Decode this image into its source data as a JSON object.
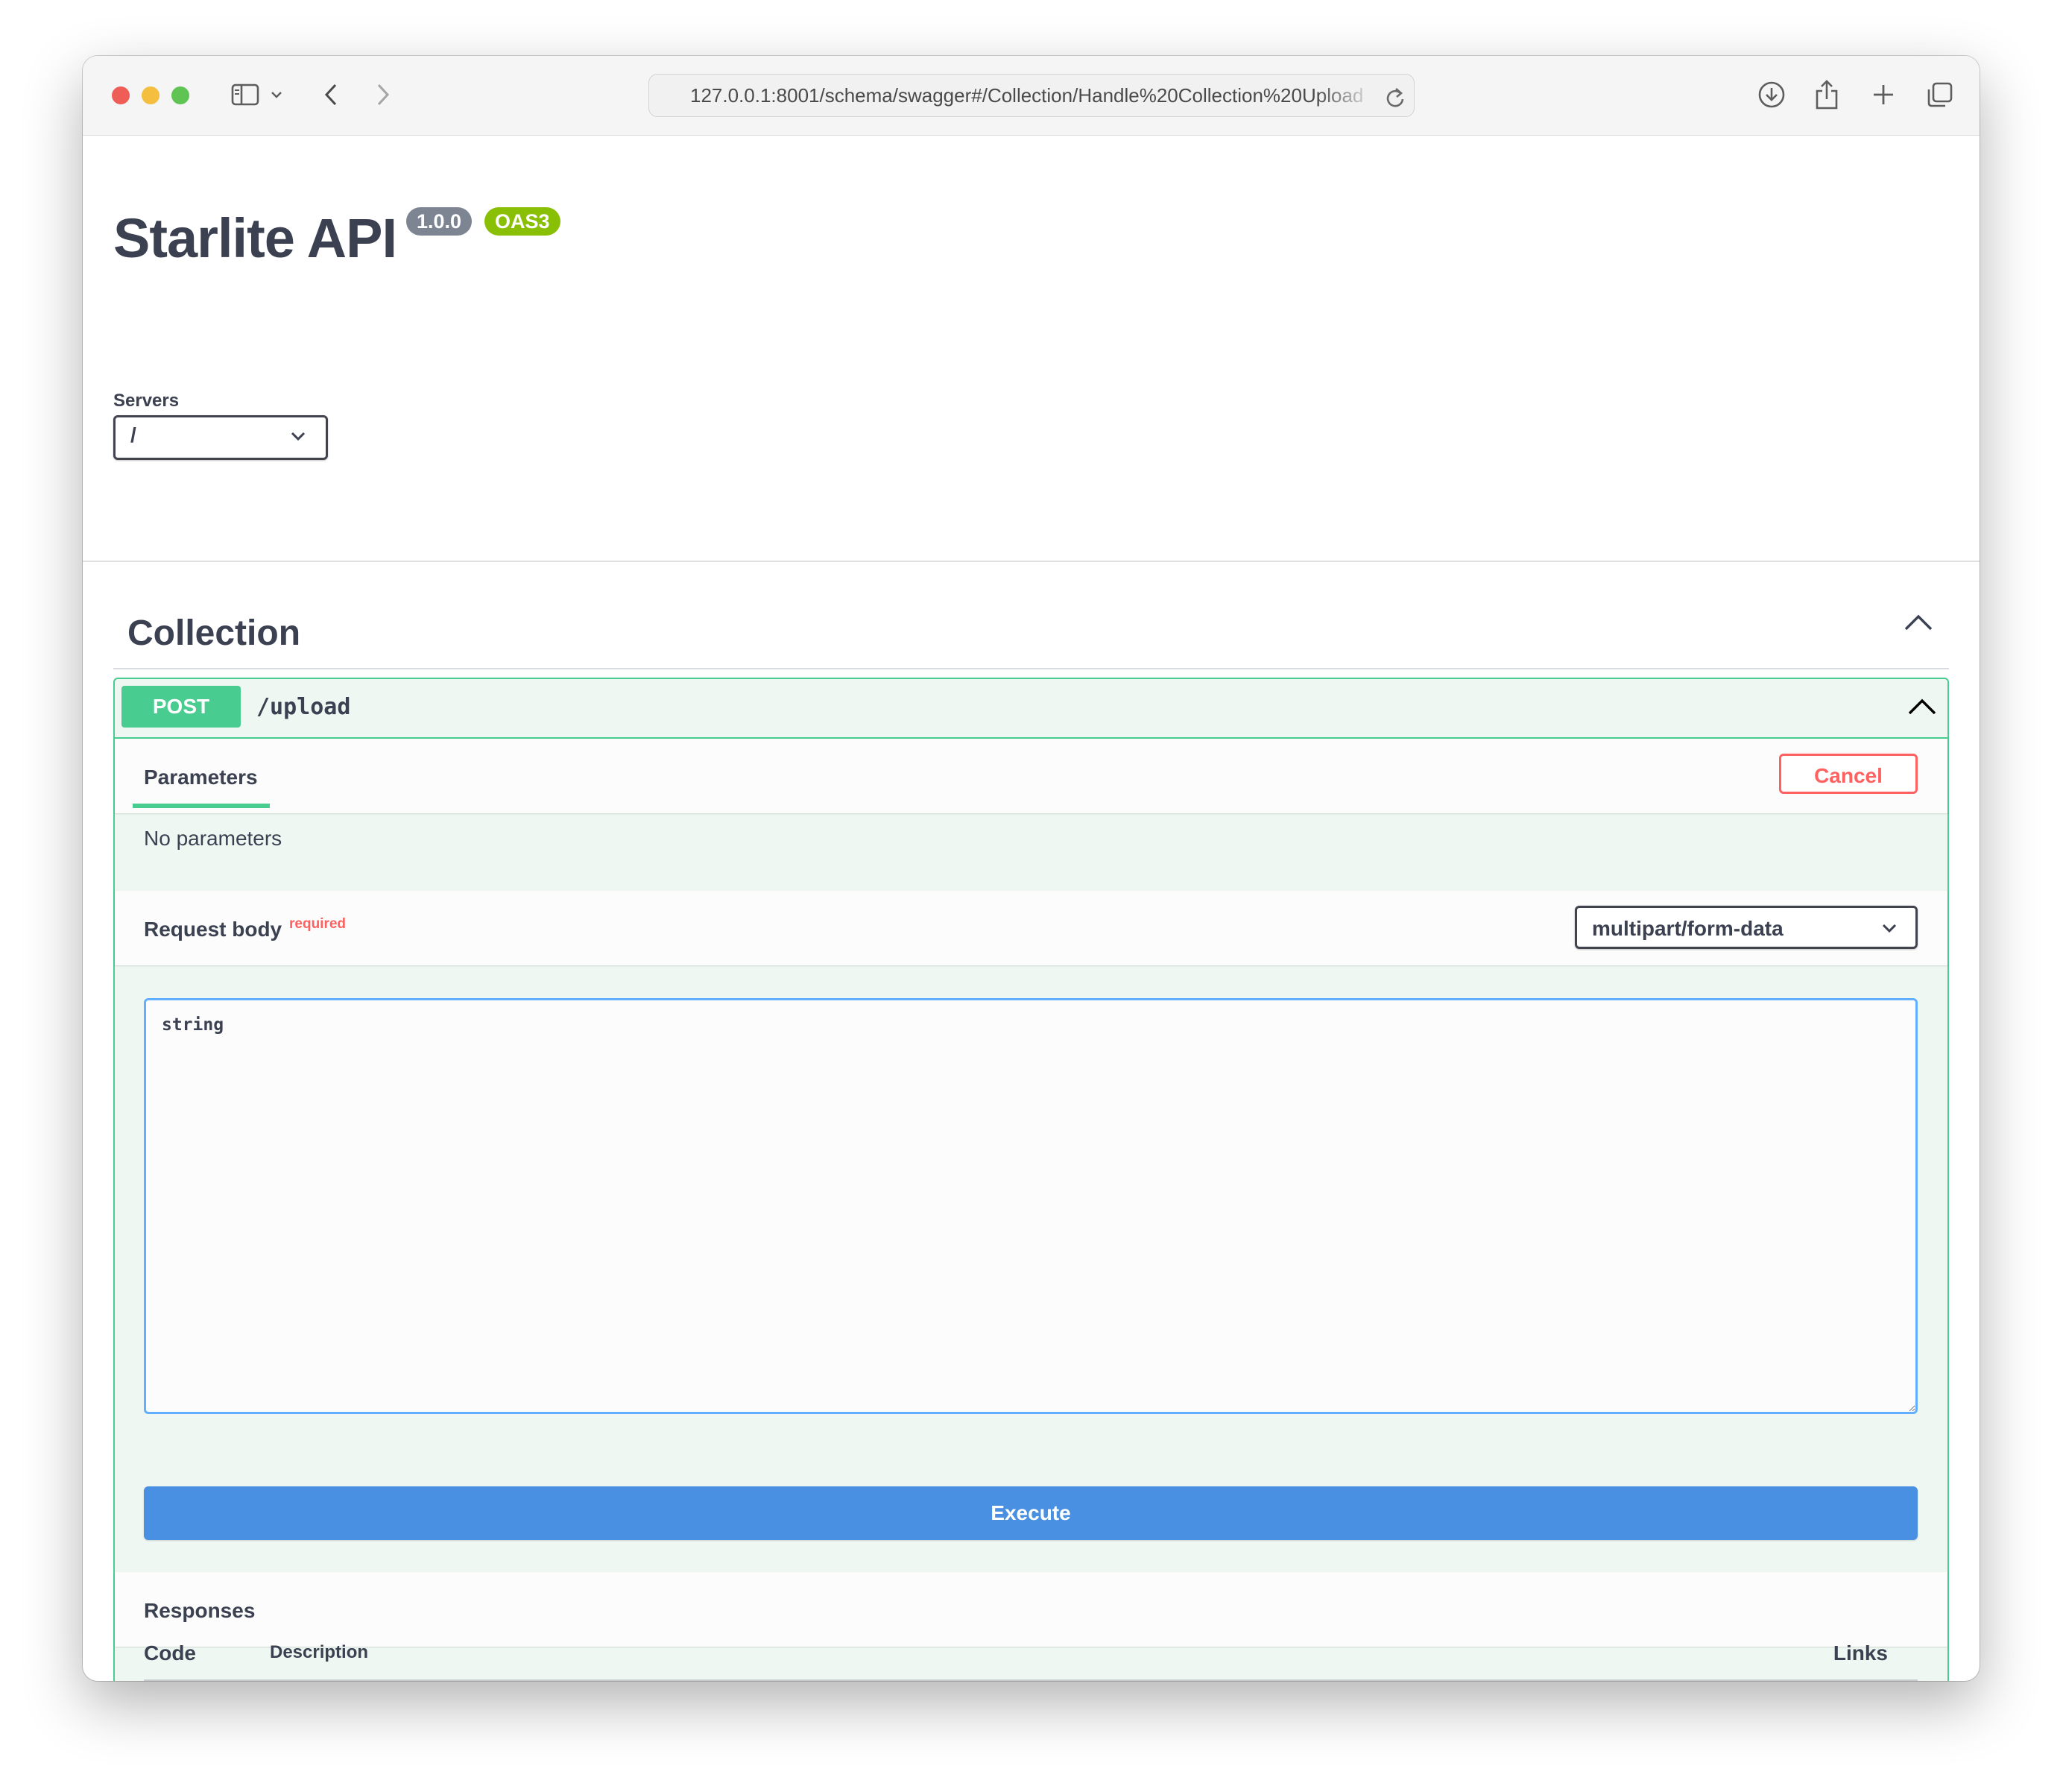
{
  "browser": {
    "url": "127.0.0.1:8001/schema/swagger#/Collection/Handle%20Collection%20Upload"
  },
  "info": {
    "title": "Starlite API",
    "version": "1.0.0",
    "spec_badge": "OAS3"
  },
  "servers": {
    "label": "Servers",
    "selected": "/"
  },
  "tag": {
    "name": "Collection"
  },
  "operation": {
    "method": "POST",
    "path": "/upload",
    "tab_label": "Parameters",
    "cancel_label": "Cancel",
    "no_params_text": "No parameters",
    "request_body_label": "Request body",
    "required_label": "required",
    "content_type": "multipart/form-data",
    "body_value": "string",
    "execute_label": "Execute",
    "responses_label": "Responses",
    "columns": {
      "code": "Code",
      "description": "Description",
      "links": "Links"
    }
  },
  "colors": {
    "post_green": "#49cc90",
    "execute_blue": "#4990e2",
    "cancel_red": "#ff6060",
    "version_badge": "#7d8492",
    "oas_badge": "#89bf04"
  },
  "icons": [
    "sidebar-icon",
    "chevron-down-icon",
    "back-arrow-icon",
    "forward-arrow-icon",
    "reload-icon",
    "download-icon",
    "share-icon",
    "new-tab-icon",
    "tabs-overview-icon",
    "chevron-up-icon"
  ]
}
